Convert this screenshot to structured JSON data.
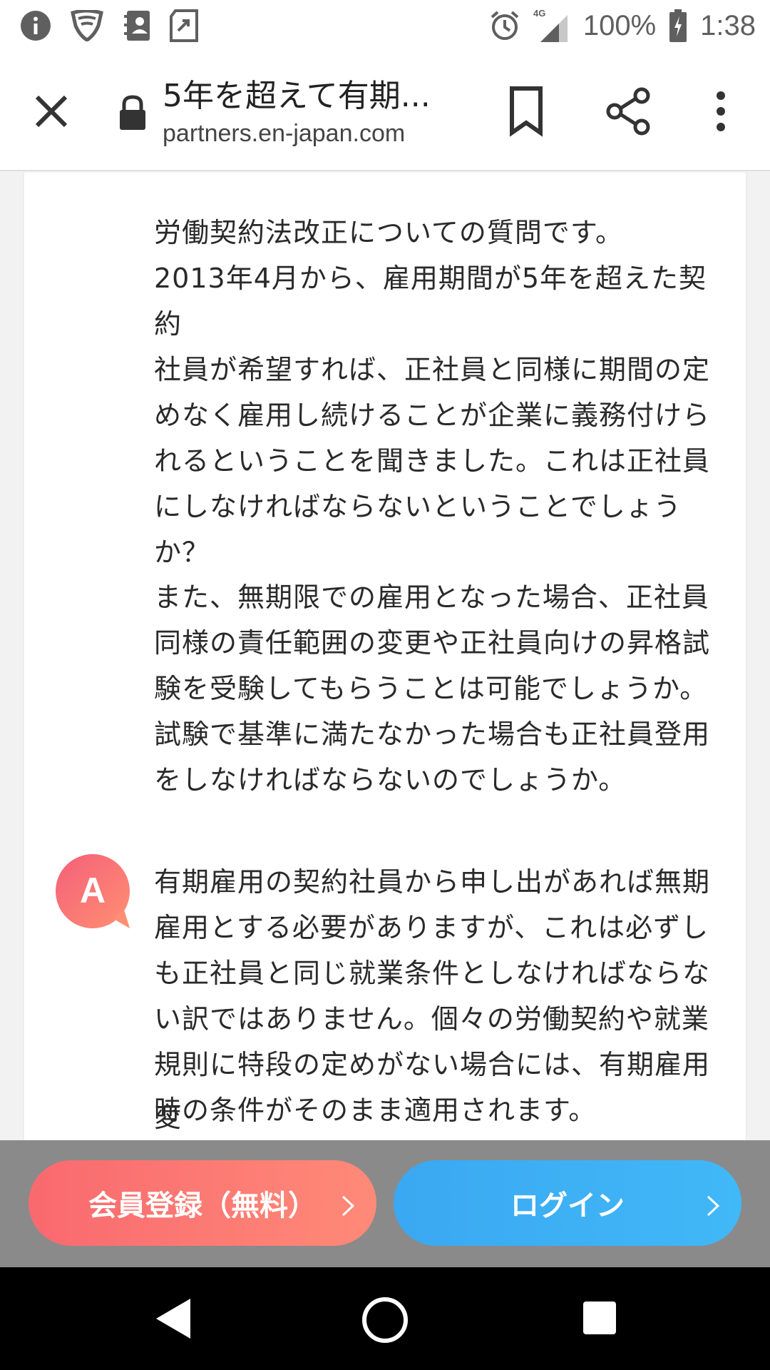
{
  "status_bar": {
    "battery": "100%",
    "time": "1:38",
    "network": "4G",
    "icons": [
      "info-icon",
      "vpn-shield-icon",
      "contacts-icon",
      "transfer-icon",
      "alarm-icon",
      "signal-icon",
      "battery-charging-icon"
    ]
  },
  "toolbar": {
    "title": "5年を超えて有期...",
    "url": "partners.en-japan.com",
    "icons": [
      "close-icon",
      "lock-icon",
      "bookmark-icon",
      "share-icon",
      "more-vert-icon"
    ]
  },
  "question": {
    "para1": "労働契約法改正についての質問です。\n2013年4月から、雇用期間が5年を超えた契約\n社員が希望すれば、正社員と同様に期間の定\nめなく雇用し続けることが企業に義務付けら\nれるということを聞きました。これは正社員\nにしなければならないということでしょう\nか？",
    "para2": "また、無期限での雇用となった場合、正社員\n同様の責任範囲の変更や正社員向けの昇格試\n験を受験してもらうことは可能でしょうか。\n試験で基準に満たなかった場合も正社員登用\nをしなければならないのでしょうか。"
  },
  "answer": {
    "badge": "A",
    "para1": "有期雇用の契約社員から申し出があれば無期\n雇用とする必要がありますが、これは必ずし\nも正社員と同じ就業条件としなければならな\nい訳ではありません。個々の労働契約や就業\n規則に特段の定めがない場合には、有期雇用\n時の条件がそのまま適用されます。",
    "para2_partial": "変\n変更もお考えの場合は、労使間の合意があれ"
  },
  "cta": {
    "register_label": "会員登録（無料）",
    "login_label": "ログイン"
  },
  "colors": {
    "register": "#f9696f",
    "login": "#3aa8f2",
    "answer_badge": "#f76f7c"
  }
}
